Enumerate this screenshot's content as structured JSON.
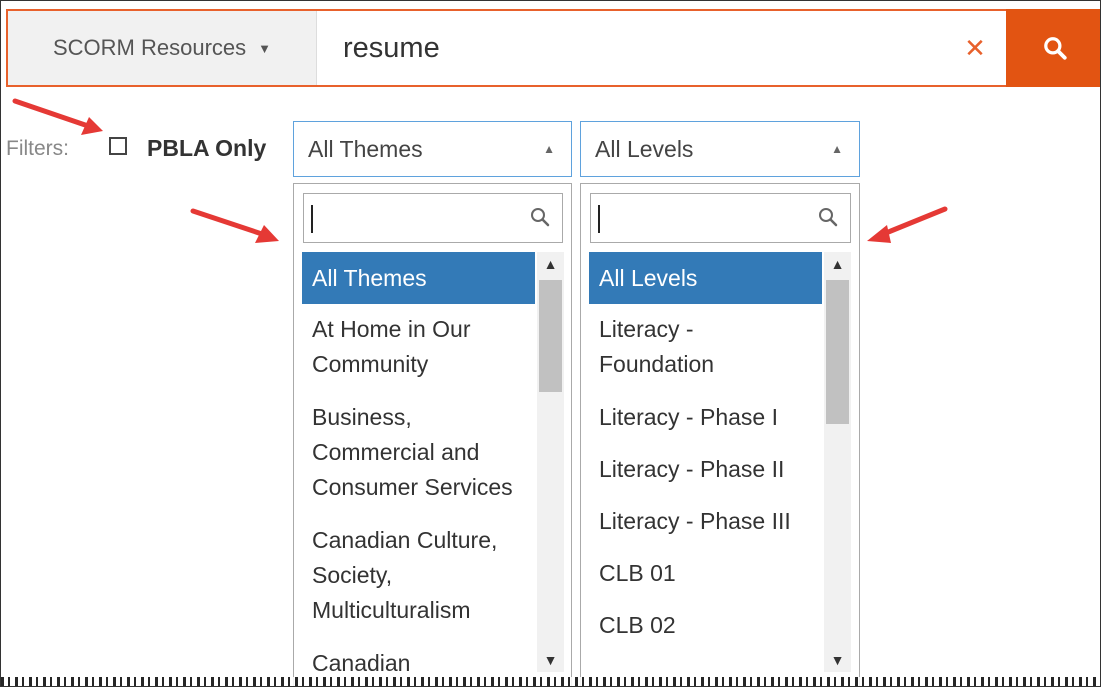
{
  "search": {
    "scope_label": "SCORM Resources",
    "query": "resume"
  },
  "filters": {
    "label": "Filters:",
    "pbla_label": "PBLA Only",
    "pbla_checked": false,
    "themes": {
      "selected": "All Themes",
      "options": [
        "All Themes",
        "At Home in Our Community",
        "Business, Commercial and Consumer Services",
        "Canadian Culture, Society, Multiculturalism",
        "Canadian"
      ]
    },
    "levels": {
      "selected": "All Levels",
      "options": [
        "All Levels",
        "Literacy - Foundation",
        "Literacy - Phase I",
        "Literacy - Phase II",
        "Literacy - Phase III",
        "CLB 01",
        "CLB 02"
      ]
    }
  },
  "colors": {
    "accent": "#e25412",
    "selected_item": "#337ab7",
    "annotation_arrow": "#e53935"
  }
}
